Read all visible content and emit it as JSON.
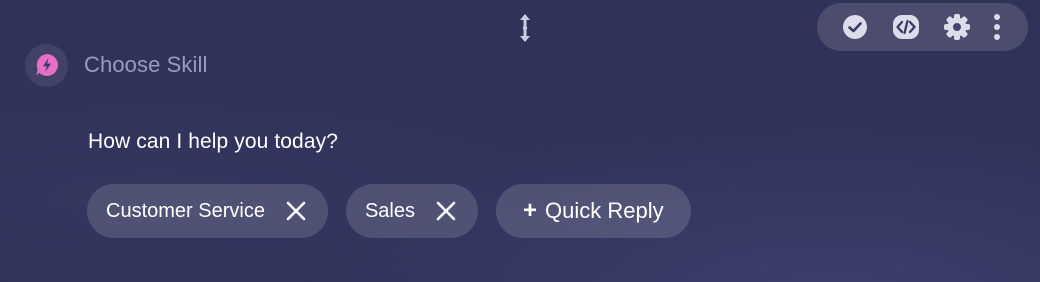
{
  "header": {
    "skill_label": "Choose Skill"
  },
  "toolbar": {
    "icons": [
      "check-circle-icon",
      "code-icon",
      "gear-icon",
      "more-vertical-icon"
    ]
  },
  "message": {
    "text": "How can I help you today?"
  },
  "quick_replies": [
    {
      "label": "Customer Service"
    },
    {
      "label": "Sales"
    }
  ],
  "add_quick_reply": {
    "plus": "+",
    "label": "Quick Reply"
  },
  "colors": {
    "background": "#313259",
    "accent": "#e56fc5",
    "muted_text": "#9a9bbd"
  }
}
